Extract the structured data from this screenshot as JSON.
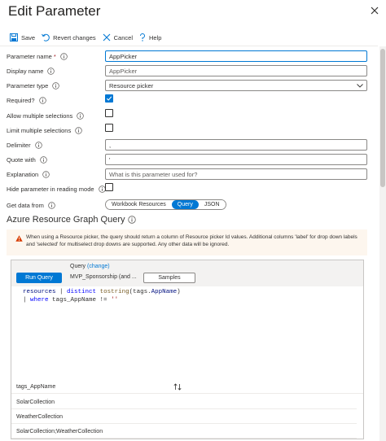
{
  "panel": {
    "title": "Edit Parameter"
  },
  "toolbar": {
    "save_label": "Save",
    "revert_label": "Revert changes",
    "cancel_label": "Cancel",
    "help_label": "Help"
  },
  "form": {
    "parameter_name": {
      "label": "Parameter name",
      "required_mark": "*",
      "value": "AppPicker"
    },
    "display_name": {
      "label": "Display name",
      "placeholder": "AppPicker"
    },
    "parameter_type": {
      "label": "Parameter type",
      "value": "Resource picker"
    },
    "required": {
      "label": "Required?",
      "checked": true
    },
    "allow_multiple": {
      "label": "Allow multiple selections",
      "checked": false
    },
    "limit_multiple": {
      "label": "Limit multiple selections",
      "checked": false
    },
    "delimiter": {
      "label": "Delimiter",
      "value": ","
    },
    "quote_with": {
      "label": "Quote with",
      "value": "'"
    },
    "explanation": {
      "label": "Explanation",
      "placeholder": "What is this parameter used for?"
    },
    "hide_reading": {
      "label": "Hide parameter in reading mode",
      "checked": false
    },
    "get_data_from": {
      "label": "Get data from",
      "options": [
        "Workbook Resources",
        "Query",
        "JSON"
      ],
      "selected": "Query"
    }
  },
  "section": {
    "title": "Azure Resource Graph Query"
  },
  "warning": {
    "text": "When using a Resource picker, the query should return a column of Resource picker Id values. Additional columns 'label' for drop down labels and 'selected' for multiselect drop downs are supported. Any other data will be ignored."
  },
  "query": {
    "label": "Query",
    "change_link": "(change)",
    "run_label": "Run Query",
    "subscription": "MVP_Sponsorship (and ...",
    "samples_label": "Samples",
    "line1": {
      "a": "resources",
      "b": " | ",
      "c": "distinct",
      "d": " ",
      "e": "tostring",
      "f": "(tags.",
      "g": "AppName",
      "h": ")"
    },
    "line2": {
      "a": "| ",
      "b": "where",
      "c": " tags_AppName ",
      "d": "!=",
      "e": " ",
      "f": "''"
    }
  },
  "results": {
    "column": "tags_AppName",
    "rows": [
      "SolarCollection",
      "WeatherCollection",
      "SolarCollection;WeatherCollection"
    ]
  },
  "colors": {
    "accent": "#0078d4",
    "warning_bg": "#fdf6ee",
    "warning_icon": "#d83b01"
  }
}
